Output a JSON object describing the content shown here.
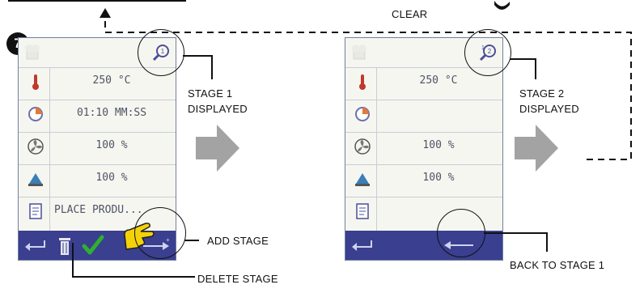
{
  "step_badge": "7",
  "labels": {
    "clear": "CLEAR",
    "stage1_line1": "STAGE 1",
    "stage1_line2": "DISPLAYED",
    "stage2_line1": "STAGE 2",
    "stage2_line2": "DISPLAYED",
    "add_stage": "ADD STAGE",
    "delete_stage": "DELETE STAGE",
    "back_to_stage1": "BACK TO STAGE 1"
  },
  "screen1": {
    "stage_indicator": "1",
    "rows": [
      {
        "icon": "thermometer-icon",
        "value": "250 °C"
      },
      {
        "icon": "clock-icon",
        "value": "01:10 MM:SS"
      },
      {
        "icon": "fan-icon",
        "value": "100 %"
      },
      {
        "icon": "humidity-icon",
        "value": "100 %"
      },
      {
        "icon": "note-icon",
        "value": "PLACE PRODU..."
      }
    ]
  },
  "screen2": {
    "stage_indicator": "2",
    "rows": [
      {
        "icon": "thermometer-icon",
        "value": "250 °C"
      },
      {
        "icon": "clock-icon",
        "value": ""
      },
      {
        "icon": "fan-icon",
        "value": "100 %"
      },
      {
        "icon": "humidity-icon",
        "value": "100 %"
      },
      {
        "icon": "note-icon",
        "value": ""
      }
    ]
  },
  "colors": {
    "screen_bg": "#f6f6f0",
    "bottom_bar": "#3a3f8f",
    "check_green": "#2fb02f",
    "hand_yellow": "#f4d20a",
    "arrow_gray": "#a3a3a3"
  }
}
